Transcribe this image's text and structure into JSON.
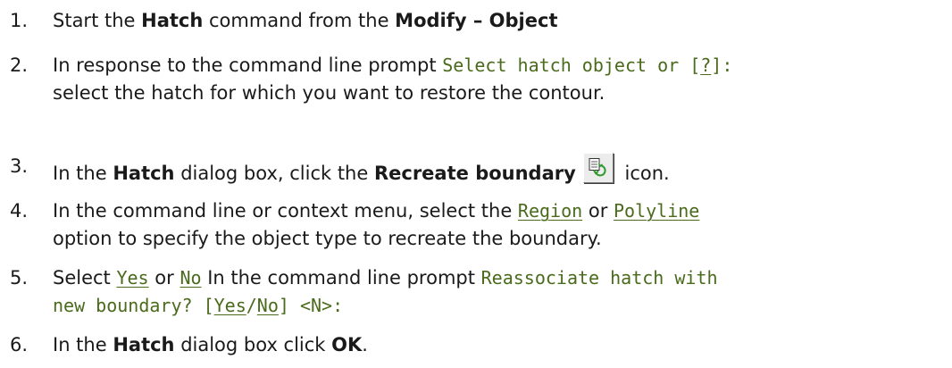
{
  "steps": [
    {
      "number": "1.",
      "parts": {
        "t1": "Start the ",
        "b1": "Hatch",
        "t2": " command from the ",
        "b2": "Modify – Object"
      }
    },
    {
      "number": "2.",
      "parts": {
        "t1": "In response to the command line prompt ",
        "c1": "Select hatch object or [",
        "o1": "?",
        "c2": "]:",
        "t2": "select the hatch for which you want to restore the contour."
      }
    },
    {
      "number": "3.",
      "parts": {
        "t1": "In the ",
        "b1": "Hatch",
        "t2": " dialog box, click the ",
        "b2": "Recreate boundary",
        "t3": " icon.",
        "icon": "recreate-boundary-icon"
      }
    },
    {
      "number": "4.",
      "parts": {
        "t1": "In the command line or context menu, select the ",
        "o1": "Region",
        "t2": " or ",
        "o2": "Polyline",
        "t3": "option to specify the object type to recreate the boundary."
      }
    },
    {
      "number": "5.",
      "parts": {
        "t1": "Select ",
        "o1": "Yes",
        "t2": " or ",
        "o2": "No",
        "t3": " In the command line prompt ",
        "c1": "Reassociate hatch with",
        "c2": "new boundary? [",
        "o3": "Yes",
        "c3": "/",
        "o4": "No",
        "c4": "] <N>:"
      }
    },
    {
      "number": "6.",
      "parts": {
        "t1": "In the ",
        "b1": "Hatch",
        "t2": " dialog box click ",
        "b2": "OK",
        "t3": "."
      }
    }
  ],
  "colors": {
    "text": "#1a1a1a",
    "code": "#4a6a1c"
  }
}
